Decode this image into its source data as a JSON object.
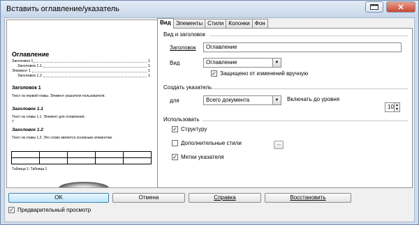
{
  "window": {
    "title": "Вставить оглавление/указатель"
  },
  "preview": {
    "title": "Оглавление",
    "toc": [
      {
        "text": "Заголовок 1",
        "page": "1"
      },
      {
        "text": "Заголовок 1.1",
        "page": "1"
      },
      {
        "text": "Элемент 1",
        "page": "1"
      },
      {
        "text": "Заголовок 1.2",
        "page": "1"
      }
    ],
    "heading1": "Заголовок 1",
    "text1": "Текст из первой главы. Элемент указателя пользователя.",
    "heading11": "Заголовок 1.1",
    "text11": "Текст из главы 1.1. Элемент для оглавления.",
    "superscript": "7",
    "heading12": "Заголовок 1.2",
    "text12": "Текст из главы 1.2. Это слово является основным элементом.",
    "table_caption": "Таблица 1: Таблица 1"
  },
  "tabs": [
    "Вид",
    "Элементы",
    "Стили",
    "Колонки",
    "Фон"
  ],
  "type_section": {
    "group_label": "Вид и заголовок",
    "title_label": "Заголовок",
    "title_value": "Оглавление",
    "type_label": "Вид",
    "type_value": "Оглавление",
    "protect_label": "Защищено от изменений вручную",
    "protect_checked": true
  },
  "create_section": {
    "group_label": "Создать указатель",
    "for_label": "для",
    "for_value": "Всего документа",
    "level_label": "Включать до уровня",
    "level_value": "10"
  },
  "use_section": {
    "group_label": "Использовать",
    "structure_label": "Структуру",
    "structure_checked": true,
    "styles_label": "Дополнительные стили",
    "styles_checked": false,
    "styles_button": "...",
    "marks_label": "Метки указателя",
    "marks_checked": true
  },
  "buttons": {
    "ok": "OK",
    "cancel": "Отмена",
    "help": "Справка",
    "reset": "Восстановить"
  },
  "preview_toggle": {
    "label": "Предварительный просмотр",
    "checked": true
  },
  "colors": {
    "titlebar": "#cfdcec",
    "close_button": "#c8472f",
    "default_button": "#bee6fd"
  }
}
